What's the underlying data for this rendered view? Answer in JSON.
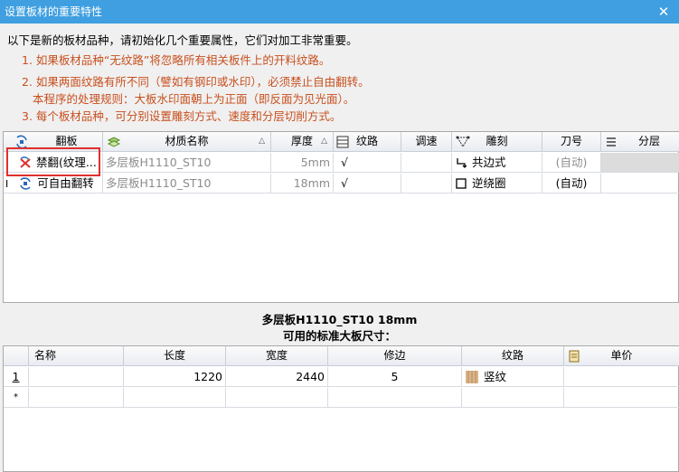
{
  "window": {
    "title": "设置板材的重要特性",
    "close_icon": "✕"
  },
  "intro": "以下是新的板材品种，请初始化几个重要属性，它们对加工非常重要。",
  "notes": [
    "1. 如果板材品种“无纹路”将忽略所有相关板件上的开料纹路。",
    "2. 如果两面纹路有所不同（譬如有钢印或水印），必须禁止自由翻转。",
    "本程序的处理规则：大板水印面朝上为正面（即反面为见光面）。",
    "3. 每个板材品种，可分别设置雕刻方式、速度和分层切削方式。"
  ],
  "materials_table": {
    "headers": [
      "翻板",
      "材质名称",
      "厚度",
      "纹路",
      "调速",
      "雕刻",
      "刀号",
      "分层"
    ],
    "rows": [
      {
        "flip": "禁翻(纹理...",
        "name": "多层板H1110_ST10",
        "thickness": "5mm",
        "grain": "√",
        "speed": "",
        "engrave": "共边式",
        "tool": "(自动)",
        "layer": ""
      },
      {
        "flip": "可自由翻转",
        "name": "多层板H1110_ST10",
        "thickness": "18mm",
        "grain": "√",
        "speed": "",
        "engrave": "逆绕圈",
        "tool": "(自动)",
        "layer": ""
      }
    ],
    "row_marker": "I"
  },
  "selected_material": "多层板H1110_ST10 18mm",
  "sizes_caption": "可用的标准大板尺寸：",
  "sizes_table": {
    "headers": [
      "名称",
      "长度",
      "宽度",
      "修边",
      "纹路",
      "单价"
    ],
    "rows": [
      {
        "index": "1",
        "name": "",
        "length": "1220",
        "width": "2440",
        "trim": "5",
        "grain": "竖纹",
        "price": ""
      }
    ],
    "new_row_marker": "*"
  }
}
